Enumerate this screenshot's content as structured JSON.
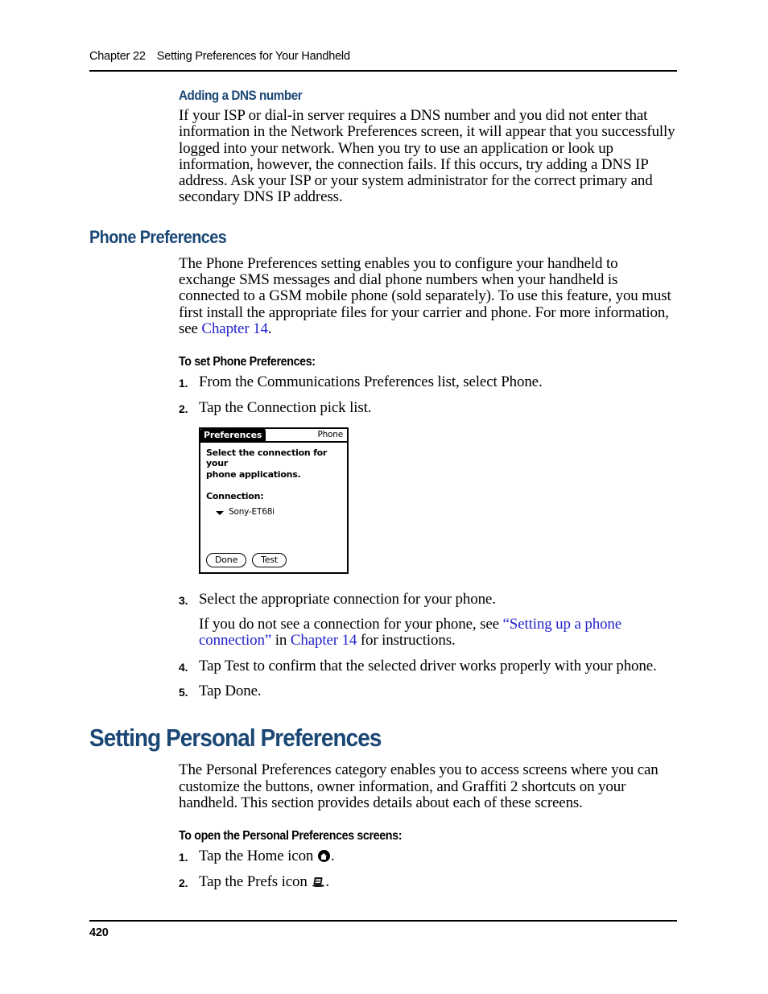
{
  "header": {
    "chapter": "Chapter 22",
    "title": "Setting Preferences for Your Handheld"
  },
  "sections": {
    "dns": {
      "heading": "Adding a DNS number",
      "paragraph": "If your ISP or dial-in server requires a DNS number and you did not enter that information in the Network Preferences screen, it will appear that you successfully logged into your network. When you try to use an application or look up information, however, the connection fails. If this occurs, try adding a DNS IP address. Ask your ISP or your system administrator for the correct primary and secondary DNS IP address."
    },
    "phone_preferences": {
      "heading": "Phone Preferences",
      "paragraph_before_link": "The Phone Preferences setting enables you to configure your handheld to exchange SMS messages and dial phone numbers when your handheld is connected to a GSM mobile phone (sold separately). To use this feature, you must first install the appropriate files for your carrier and phone. For more information, see ",
      "paragraph_link": "Chapter 14",
      "paragraph_after_link": ".",
      "procedure_heading": "To set Phone Preferences:",
      "steps": [
        {
          "num": "1.",
          "text": "From the Communications Preferences list, select Phone."
        },
        {
          "num": "2.",
          "text": "Tap the Connection pick list."
        },
        {
          "num": "3.",
          "text": "Select the appropriate connection for your phone."
        },
        {
          "num": "4.",
          "text": "Tap Test to confirm that the selected driver works properly with your phone."
        },
        {
          "num": "5.",
          "text": "Tap Done."
        }
      ],
      "step3_note_before": "If you do not see a connection for your phone, see ",
      "step3_note_link1": "“Setting up a phone connection”",
      "step3_note_middle": " in ",
      "step3_note_link2": "Chapter 14",
      "step3_note_after": " for instructions."
    },
    "personal_preferences": {
      "heading": "Setting Personal Preferences",
      "paragraph": "The Personal Preferences category enables you to access screens where you can customize the buttons, owner information, and Graffiti 2 shortcuts on your handheld. This section provides details about each of these screens.",
      "procedure_heading": "To open the Personal Preferences screens:",
      "steps": [
        {
          "num": "1.",
          "text_before": "Tap the Home icon ",
          "icon": "home-icon",
          "text_after": "."
        },
        {
          "num": "2.",
          "text_before": "Tap the Prefs icon ",
          "icon": "prefs-icon",
          "text_after": "."
        }
      ]
    }
  },
  "figure": {
    "title_tab": "Preferences",
    "title_right": "Phone",
    "instruction_line1": "Select the connection for your",
    "instruction_line2": "phone applications.",
    "connection_label": "Connection:",
    "connection_value": "Sony-ET68i",
    "button_done": "Done",
    "button_test": "Test"
  },
  "footer": {
    "page_number": "420"
  },
  "colors": {
    "heading_blue": "#1b4775",
    "link_blue": "#2222cc",
    "text_black": "#000000",
    "page_background": "#ffffff"
  }
}
